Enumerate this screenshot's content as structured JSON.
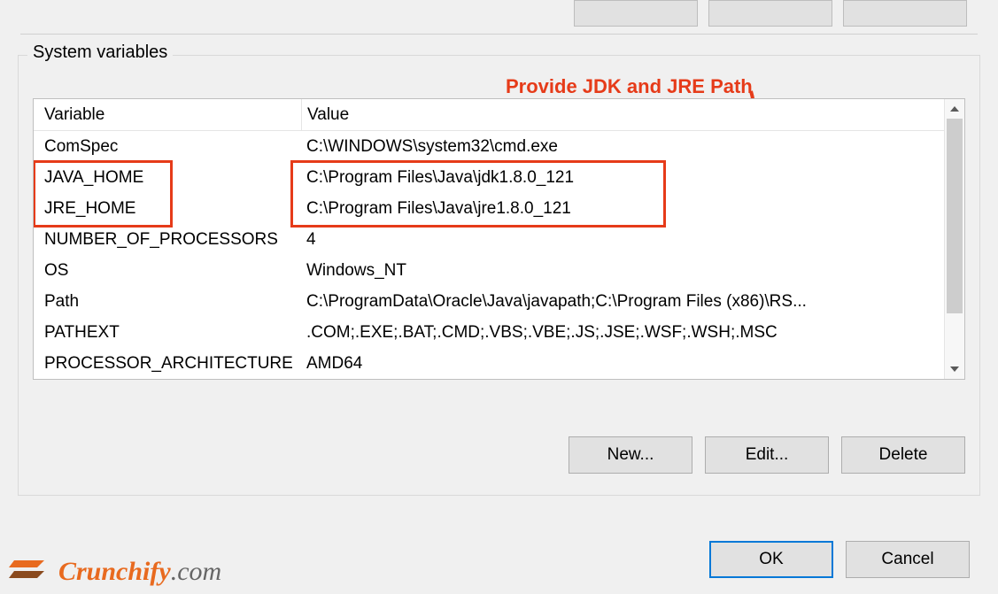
{
  "group": {
    "title": "System variables",
    "annotation": "Provide JDK and JRE Path",
    "columns": {
      "c1": "Variable",
      "c2": "Value"
    },
    "rows": [
      {
        "var": "ComSpec",
        "val": "C:\\WINDOWS\\system32\\cmd.exe"
      },
      {
        "var": "JAVA_HOME",
        "val": "C:\\Program Files\\Java\\jdk1.8.0_121"
      },
      {
        "var": "JRE_HOME",
        "val": "C:\\Program Files\\Java\\jre1.8.0_121"
      },
      {
        "var": "NUMBER_OF_PROCESSORS",
        "val": "4"
      },
      {
        "var": "OS",
        "val": "Windows_NT"
      },
      {
        "var": "Path",
        "val": "C:\\ProgramData\\Oracle\\Java\\javapath;C:\\Program Files (x86)\\RS..."
      },
      {
        "var": "PATHEXT",
        "val": ".COM;.EXE;.BAT;.CMD;.VBS;.VBE;.JS;.JSE;.WSF;.WSH;.MSC"
      },
      {
        "var": "PROCESSOR_ARCHITECTURE",
        "val": "AMD64"
      }
    ],
    "buttons": {
      "new": "New...",
      "edit": "Edit...",
      "delete": "Delete"
    }
  },
  "dialog_buttons": {
    "ok": "OK",
    "cancel": "Cancel"
  },
  "watermark": {
    "brand": "Crunchify",
    "suffix": ".com"
  }
}
